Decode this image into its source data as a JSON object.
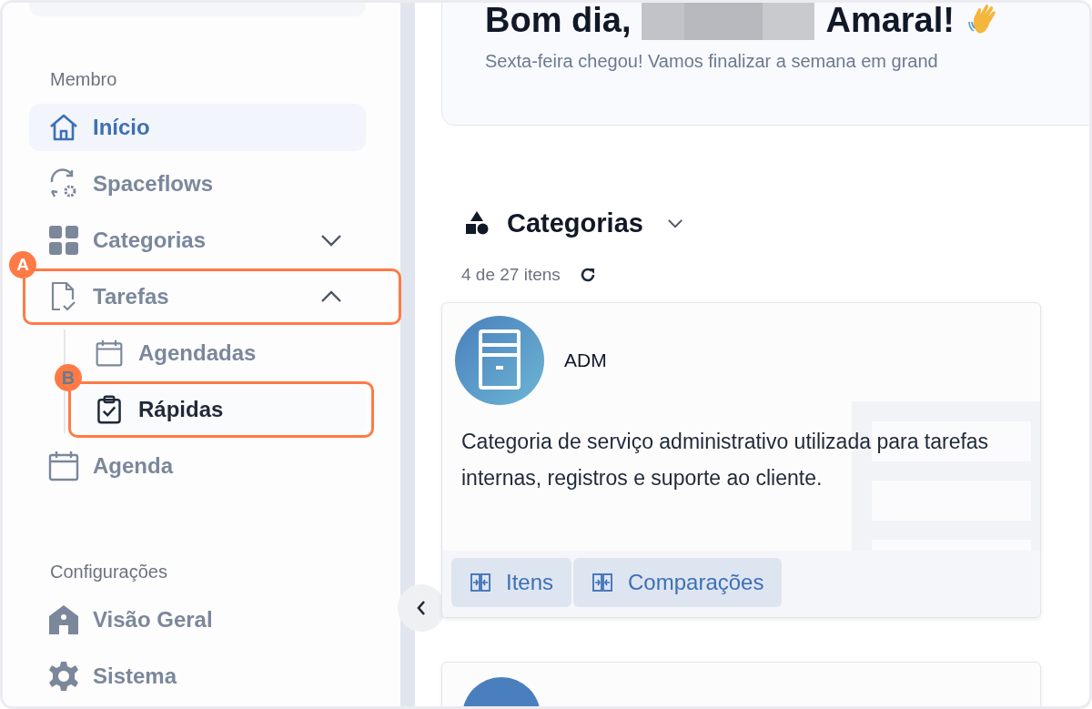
{
  "sidebar": {
    "sections": [
      {
        "title": "Membro",
        "items": [
          {
            "label": "Início",
            "selected": true
          },
          {
            "label": "Spaceflows",
            "selected": false
          },
          {
            "label": "Categorias",
            "selected": false,
            "expanded": false
          },
          {
            "label": "Tarefas",
            "selected": false,
            "expanded": true,
            "annotation": "A",
            "children": [
              {
                "label": "Agendadas",
                "highlighted": false
              },
              {
                "label": "Rápidas",
                "highlighted": true,
                "annotation": "B"
              }
            ]
          },
          {
            "label": "Agenda",
            "selected": false
          }
        ]
      },
      {
        "title": "Configurações",
        "items": [
          {
            "label": "Visão Geral",
            "selected": false
          },
          {
            "label": "Sistema",
            "selected": false
          }
        ]
      }
    ]
  },
  "greeting": {
    "prefix": "Bom dia,",
    "suffix": "Amaral!",
    "subtitle": "Sexta-feira chegou! Vamos finalizar a semana em grand"
  },
  "categories": {
    "title": "Categorias",
    "count": "4 de 27 itens",
    "cards": [
      {
        "title": "ADM",
        "description": "Categoria de serviço administrativo utilizada para tarefas internas, registros e suporte ao cliente.",
        "actions": [
          "Itens",
          "Comparações"
        ]
      }
    ]
  }
}
